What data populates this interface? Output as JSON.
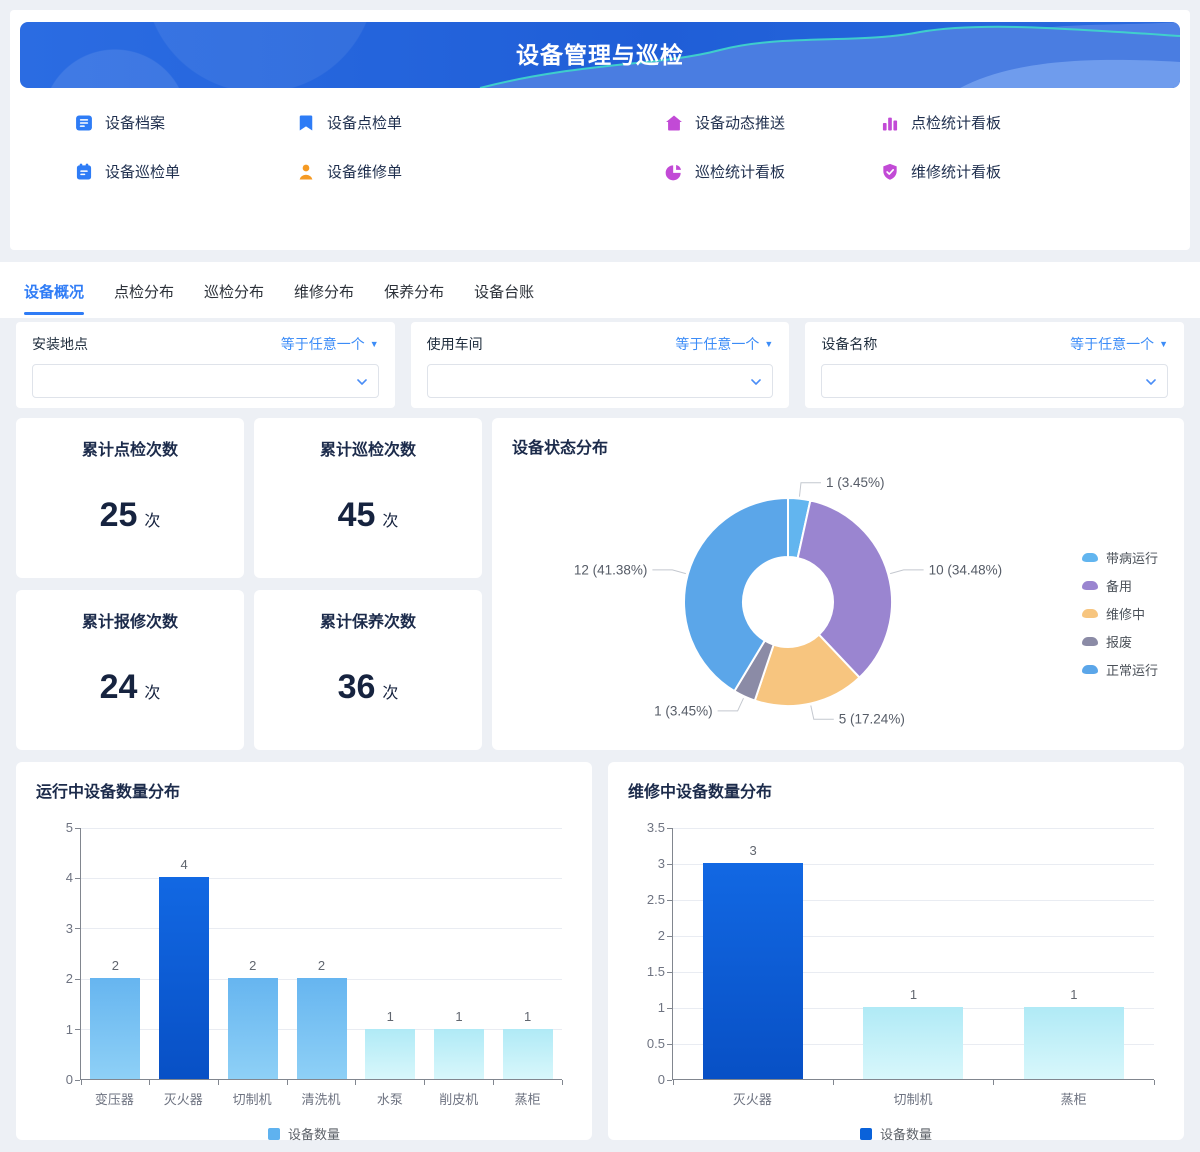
{
  "banner": {
    "title": "设备管理与巡检",
    "bg_from": "#2b6ce2",
    "bg_to": "#1f5ed7",
    "wave_accent": "#3fd8ca"
  },
  "menu": {
    "items": [
      {
        "label": "设备档案",
        "icon": "document-list-icon",
        "color": "#2e7cf6"
      },
      {
        "label": "设备点检单",
        "icon": "bookmark-icon",
        "color": "#2e7cf6"
      },
      {
        "label": "设备动态推送",
        "icon": "home-icon",
        "color": "#c24ad6"
      },
      {
        "label": "点检统计看板",
        "icon": "bar-chart-icon",
        "color": "#c24ad6"
      },
      {
        "label": "设备巡检单",
        "icon": "clipboard-icon",
        "color": "#2e7cf6"
      },
      {
        "label": "设备维修单",
        "icon": "person-icon",
        "color": "#f59a23"
      },
      {
        "label": "巡检统计看板",
        "icon": "pie-chart-icon",
        "color": "#c24ad6"
      },
      {
        "label": "维修统计看板",
        "icon": "shield-check-icon",
        "color": "#c24ad6"
      }
    ]
  },
  "tabs": {
    "items": [
      {
        "label": "设备概况",
        "active": true
      },
      {
        "label": "点检分布",
        "active": false
      },
      {
        "label": "巡检分布",
        "active": false
      },
      {
        "label": "维修分布",
        "active": false
      },
      {
        "label": "保养分布",
        "active": false
      },
      {
        "label": "设备台账",
        "active": false
      }
    ]
  },
  "filters": {
    "fields": [
      {
        "label": "安装地点",
        "operator": "等于任意一个",
        "value": ""
      },
      {
        "label": "使用车间",
        "operator": "等于任意一个",
        "value": ""
      },
      {
        "label": "设备名称",
        "operator": "等于任意一个",
        "value": ""
      }
    ]
  },
  "stats": {
    "cards": [
      {
        "title": "累计点检次数",
        "value": "25",
        "unit": "次"
      },
      {
        "title": "累计巡检次数",
        "value": "45",
        "unit": "次"
      },
      {
        "title": "累计报修次数",
        "value": "24",
        "unit": "次"
      },
      {
        "title": "累计保养次数",
        "value": "36",
        "unit": "次"
      }
    ]
  },
  "chart_data": [
    {
      "type": "pie",
      "title": "设备状态分布",
      "donut": true,
      "legend_position": "right",
      "labels": [
        "带病运行",
        "备用",
        "维修中",
        "报废",
        "正常运行"
      ],
      "values": [
        1,
        10,
        5,
        1,
        12
      ],
      "percents": [
        "3.45%",
        "34.48%",
        "17.24%",
        "3.45%",
        "41.38%"
      ],
      "colors": [
        "#62b5ef",
        "#9a85d0",
        "#f7c57f",
        "#8b8ba6",
        "#5ba6e9"
      ]
    },
    {
      "type": "bar",
      "title": "运行中设备数量分布",
      "categories": [
        "变压器",
        "灭火器",
        "切制机",
        "清洗机",
        "水泵",
        "削皮机",
        "蒸柜"
      ],
      "values": [
        2,
        4,
        2,
        2,
        1,
        1,
        1
      ],
      "ylim": [
        0,
        5
      ],
      "ytick_step": 1,
      "grid": true,
      "legend": "设备数量",
      "legend_color": "#5fb2ef",
      "bar_colors": [
        [
          "#66b5f0",
          "#8ed0f6"
        ],
        [
          "#1268e3",
          "#0850c5"
        ],
        [
          "#66b5f0",
          "#8ed0f6"
        ],
        [
          "#66b5f0",
          "#8ed0f6"
        ],
        [
          "#b0eaf6",
          "#d8f7fb"
        ],
        [
          "#b0eaf6",
          "#d8f7fb"
        ],
        [
          "#b0eaf6",
          "#d8f7fb"
        ]
      ]
    },
    {
      "type": "bar",
      "title": "维修中设备数量分布",
      "categories": [
        "灭火器",
        "切制机",
        "蒸柜"
      ],
      "values": [
        3,
        1,
        1
      ],
      "ylim": [
        0,
        3.5
      ],
      "ytick_step": 0.5,
      "grid": true,
      "legend": "设备数量",
      "legend_color": "#0a62da",
      "bar_colors": [
        [
          "#1268e3",
          "#0850c5"
        ],
        [
          "#b0eaf6",
          "#d8f7fb"
        ],
        [
          "#b0eaf6",
          "#d8f7fb"
        ]
      ]
    }
  ],
  "theme": {
    "accent_blue": "#2f7cf6",
    "page_bg": "#edf0f5",
    "text_navy": "#1c2b4b",
    "axis_label": "#6e7381",
    "data_label": "#61666f"
  }
}
